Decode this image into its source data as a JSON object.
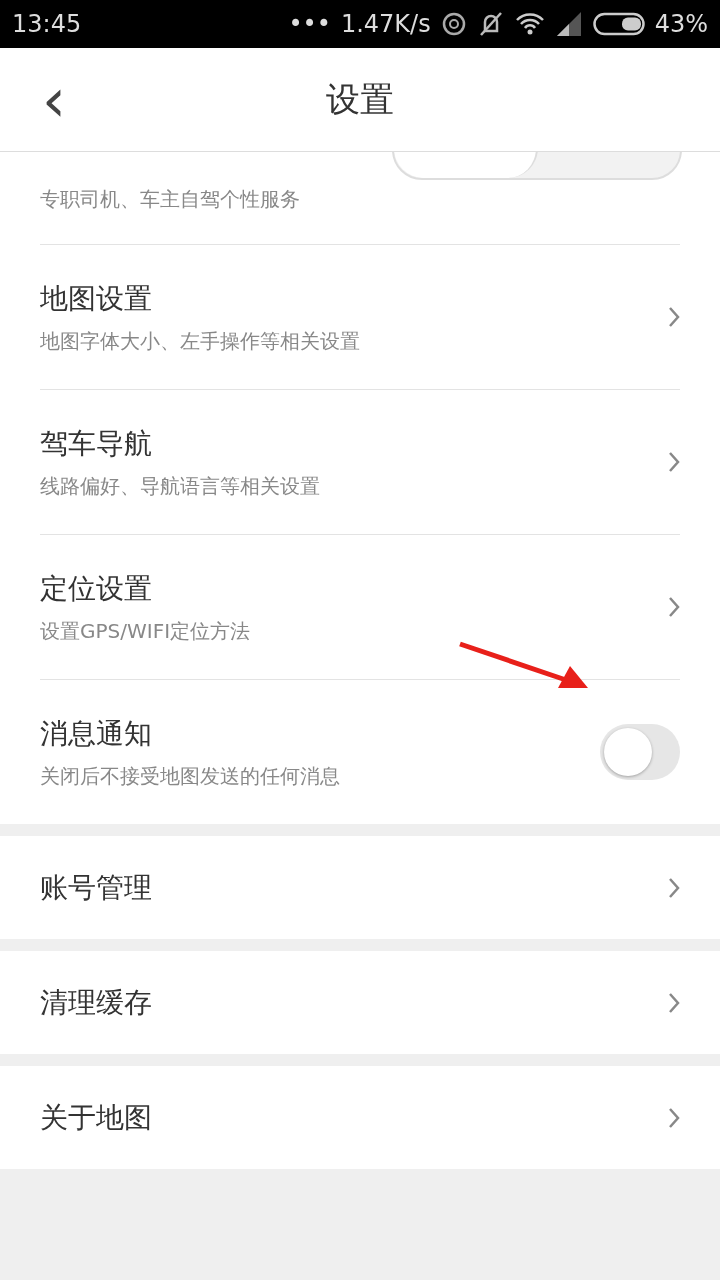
{
  "status_bar": {
    "time": "13:45",
    "dots": "•••",
    "speed": "1.47K/s",
    "battery": "43%"
  },
  "header": {
    "back": "‹",
    "title": "设置"
  },
  "mode_row": {
    "subtitle": "专职司机、车主自驾个性服务",
    "segments": [
      {
        "selected": true
      },
      {
        "selected": false
      }
    ]
  },
  "groups": [
    [
      {
        "kind": "link",
        "title": "地图设置",
        "subtitle": "地图字体大小、左手操作等相关设置"
      },
      {
        "kind": "link",
        "title": "驾车导航",
        "subtitle": "线路偏好、导航语言等相关设置"
      },
      {
        "kind": "link",
        "title": "定位设置",
        "subtitle": "设置GPS/WIFI定位方法"
      },
      {
        "kind": "toggle",
        "title": "消息通知",
        "subtitle": "关闭后不接受地图发送的任何消息",
        "on": false
      }
    ],
    [
      {
        "kind": "link",
        "title": "账号管理"
      }
    ],
    [
      {
        "kind": "link",
        "title": "清理缓存"
      }
    ],
    [
      {
        "kind": "link",
        "title": "关于地图"
      }
    ]
  ]
}
